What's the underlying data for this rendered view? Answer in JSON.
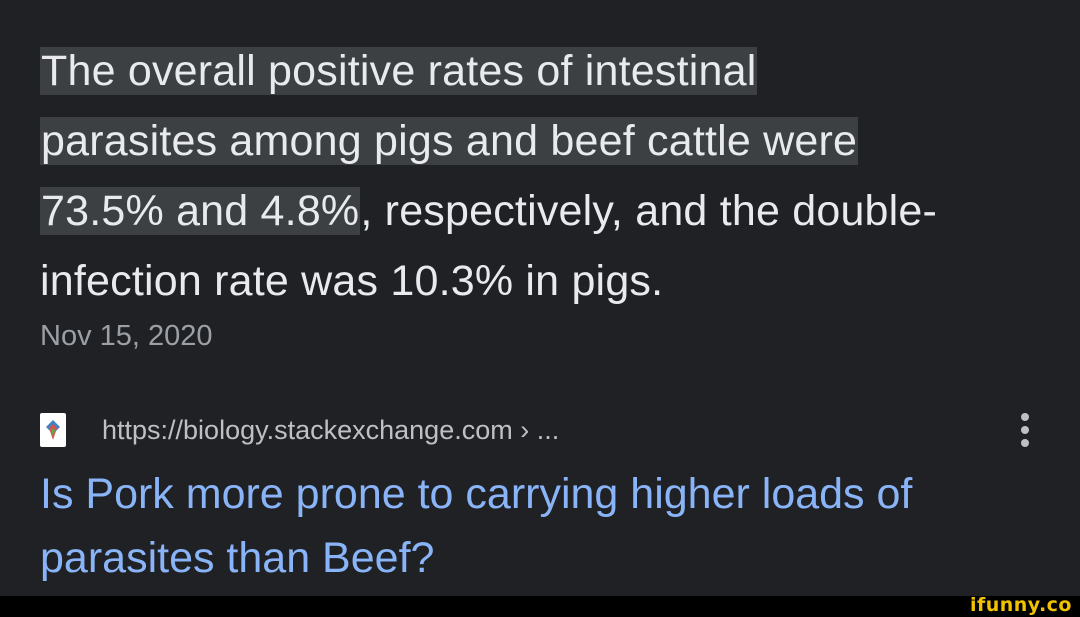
{
  "snippet": {
    "highlight_1": "The overall positive rates of intestinal",
    "highlight_2": "parasites among pigs and beef cattle were",
    "highlight_3": "73.5% and 4.8%",
    "rest": ", respectively, and the double-infection rate was 10.3% in pigs.",
    "date": "Nov 15, 2020"
  },
  "source": {
    "favicon": "stackexchange-icon",
    "url": "https://biology.stackexchange.com › ...",
    "menu_icon": "more-vert-icon"
  },
  "result": {
    "title": "Is Pork more prone to carrying higher loads of parasites than Beef?"
  },
  "watermark": {
    "text": "ifunny.co"
  },
  "colors": {
    "background": "#202124",
    "highlight_bg": "#3c4043",
    "link": "#8ab4f8",
    "secondary_text": "#9aa0a6",
    "watermark": "#f2c200"
  }
}
